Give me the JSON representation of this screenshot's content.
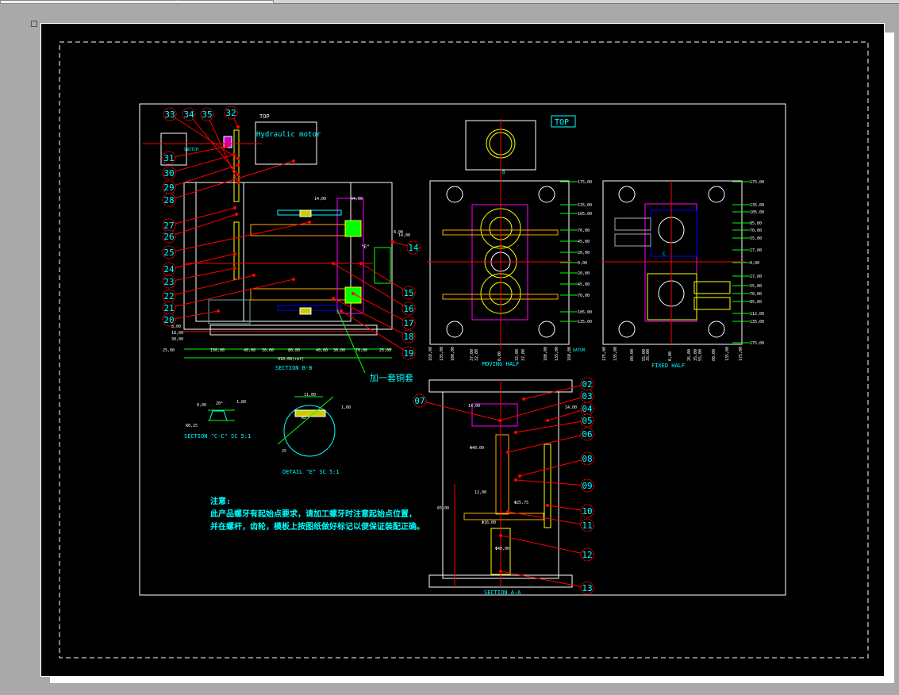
{
  "drawing": {
    "top_label_small": "TOP",
    "hydraulic_motor": "Hydraulic motor",
    "switch_label": "SWITCH",
    "section_bb": "SECTION B-B",
    "bronze_sleeve_note": "加一套铜套",
    "top_box": "TOP",
    "moving_half": "MOVING HALF",
    "fixed_half": "FIXED HALF",
    "datum": "DATUM",
    "section_cc": "SECTION \"C-C\" SC 5:1",
    "detail_e": "DETAIL \"E\" SC 5:1",
    "section_aa": "SECTION A-A",
    "section_marker_b": "B",
    "section_marker_c": "C",
    "detail_marker_e": "\"E\"",
    "notes": {
      "title": "注意:",
      "line1": "此产品螺牙有起始点要求，请加工螺牙时注意起始点位置，",
      "line2": "并在螺杆，齿轮，模板上按图纸做好标记以便保证装配正确。"
    }
  },
  "balloons": [
    "33",
    "34",
    "35",
    "32",
    "31",
    "30",
    "29",
    "28",
    "27",
    "26",
    "25",
    "24",
    "23",
    "22",
    "21",
    "20",
    "14",
    "15",
    "16",
    "17",
    "18",
    "19",
    "02",
    "03",
    "04",
    "05",
    "06",
    "07",
    "08",
    "09",
    "10",
    "11",
    "12",
    "13"
  ],
  "dimensions": {
    "section_bb_bottom": [
      "25,00",
      "150,00",
      "40,00",
      "30,00",
      "80,00",
      "40,00",
      "30,00",
      "70,00",
      "25,00"
    ],
    "section_bb_overall": "410,00(ref)",
    "section_bb_left": [
      "8,00",
      "18,00",
      "30,00"
    ],
    "section_bb_top": [
      "14,00",
      "44,00"
    ],
    "section_bb_right": [
      "8,00",
      "14,00"
    ],
    "moving_half_right": [
      "175,00",
      "135,00",
      "105,00",
      "70,00",
      "45,00",
      "20,00",
      "0,00",
      "20,00",
      "45,00",
      "70,00",
      "105,00",
      "135,00"
    ],
    "moving_half_bottom": [
      "160,00",
      "135,00",
      "100,00",
      "37,00",
      "32,00",
      "0,00",
      "32,00",
      "37,00",
      "100,00",
      "135,00",
      "160,00"
    ],
    "fixed_half_right": [
      "175,00",
      "135,00",
      "105,00",
      "85,00",
      "70,00",
      "55,00",
      "27,00",
      "0,00",
      "27,00",
      "55,00",
      "70,00",
      "85,00",
      "112,00",
      "135,00",
      "175,00"
    ],
    "fixed_half_bottom": [
      "175,00",
      "135,00",
      "80,00",
      "55,00",
      "35,00",
      "0,00",
      "26,00",
      "35,00",
      "55,00",
      "80,00",
      "135,00",
      "175,00"
    ],
    "section_cc": [
      "20°",
      "0,00",
      "R0,25",
      "1,80"
    ],
    "detail_e": [
      "11,00",
      "1,60",
      "R2",
      "25"
    ],
    "section_aa": [
      "14,00",
      "Φ40,00",
      "12,00",
      "Φ25,75",
      "Φ16,00",
      "Φ40,00",
      "65,00",
      "14,00"
    ]
  },
  "colors": {
    "background": "#000000",
    "frame": "#ffffff",
    "balloon": "#ff0000",
    "balloon_text": "#00ffff",
    "dimension": "#00ff00",
    "title_text": "#00ffff"
  }
}
